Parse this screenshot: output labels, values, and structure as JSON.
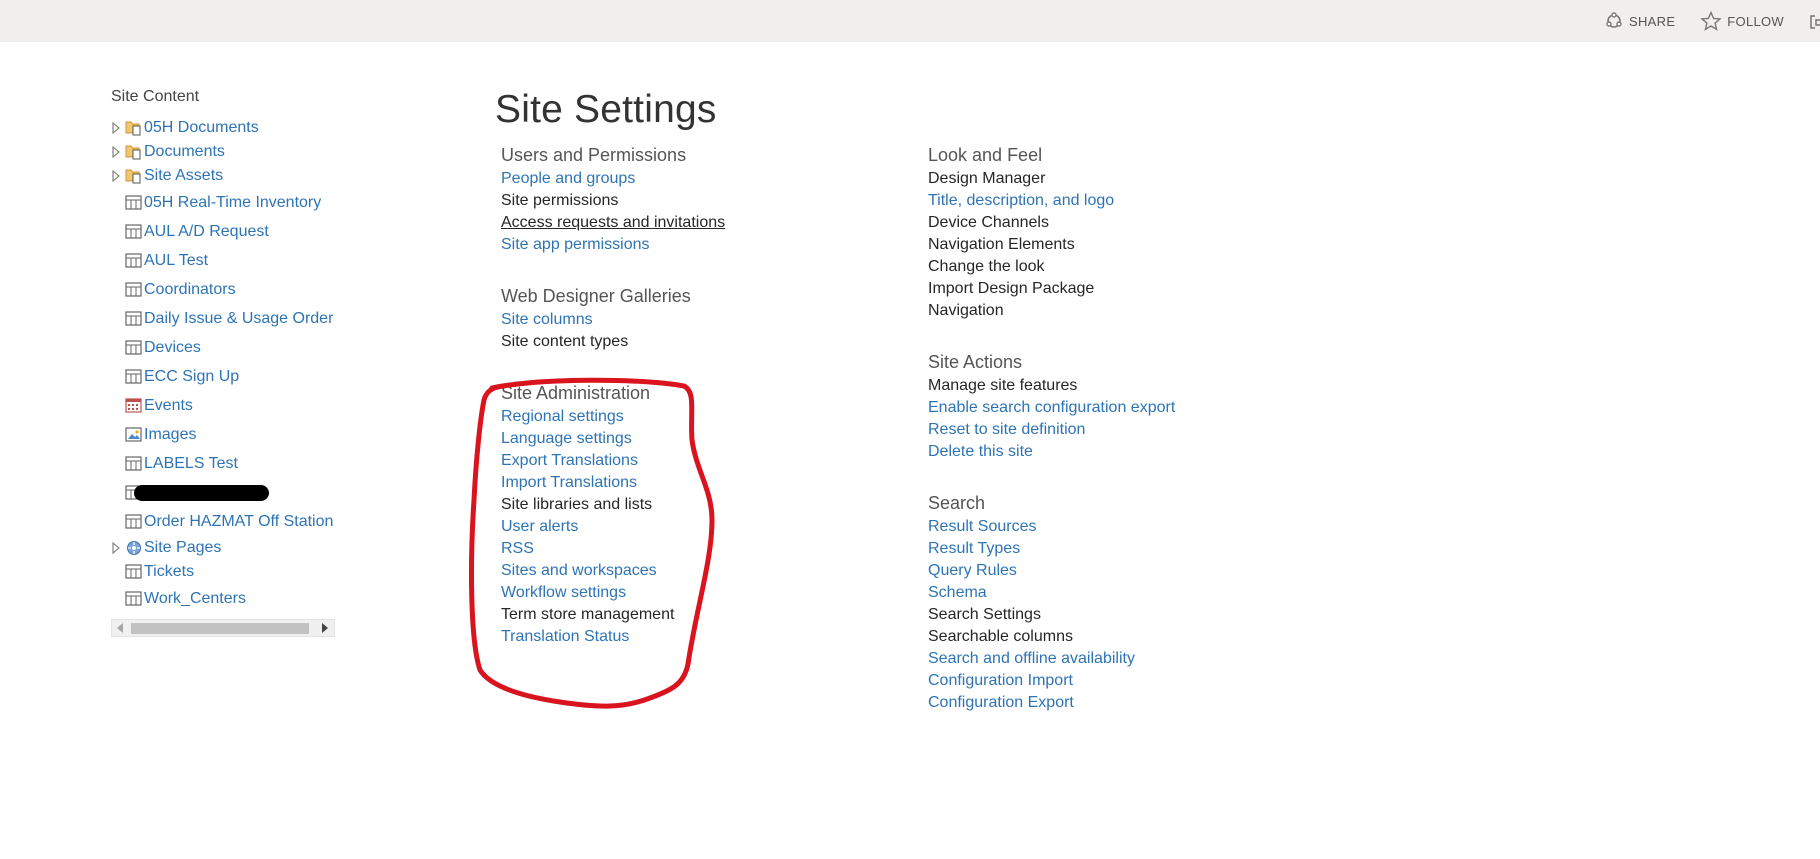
{
  "topbar": {
    "share_label": "SHARE",
    "follow_label": "FOLLOW"
  },
  "leftnav": {
    "title": "Site Content",
    "items": [
      {
        "label": "05H Documents",
        "icon": "library-folder-icon",
        "expandable": true
      },
      {
        "label": "Documents",
        "icon": "library-folder-icon",
        "expandable": true
      },
      {
        "label": "Site Assets",
        "icon": "library-folder-icon",
        "expandable": true
      },
      {
        "label": "05H Real-Time Inventory",
        "icon": "list-icon",
        "expandable": false
      },
      {
        "label": "AUL A/D Request",
        "icon": "list-icon",
        "expandable": false
      },
      {
        "label": "AUL Test",
        "icon": "list-icon",
        "expandable": false
      },
      {
        "label": "Coordinators",
        "icon": "list-icon",
        "expandable": false
      },
      {
        "label": "Daily Issue & Usage Order",
        "icon": "list-icon",
        "expandable": false
      },
      {
        "label": "Devices",
        "icon": "list-icon",
        "expandable": false
      },
      {
        "label": "ECC Sign Up",
        "icon": "list-icon",
        "expandable": false
      },
      {
        "label": "Events",
        "icon": "calendar-icon",
        "expandable": false
      },
      {
        "label": "Images",
        "icon": "image-library-icon",
        "expandable": false
      },
      {
        "label": "LABELS Test",
        "icon": "list-icon",
        "expandable": false
      },
      {
        "label": "",
        "icon": "list-icon",
        "expandable": false,
        "redacted": true
      },
      {
        "label": "Order HAZMAT Off Station",
        "icon": "list-icon",
        "expandable": false
      },
      {
        "label": "Site Pages",
        "icon": "site-pages-icon",
        "expandable": true
      },
      {
        "label": "Tickets",
        "icon": "list-icon",
        "expandable": false
      },
      {
        "label": "Work_Centers",
        "icon": "list-icon",
        "expandable": false
      }
    ]
  },
  "main": {
    "title": "Site Settings",
    "left_column": [
      {
        "title": "Users and Permissions",
        "links": [
          {
            "label": "People and groups",
            "style": "blue"
          },
          {
            "label": "Site permissions",
            "style": "dark"
          },
          {
            "label": "Access requests and invitations",
            "style": "underline"
          },
          {
            "label": "Site app permissions",
            "style": "blue"
          }
        ]
      },
      {
        "title": "Web Designer Galleries",
        "links": [
          {
            "label": "Site columns",
            "style": "blue"
          },
          {
            "label": "Site content types",
            "style": "dark"
          }
        ]
      },
      {
        "title": "Site Administration",
        "links": [
          {
            "label": "Regional settings",
            "style": "blue"
          },
          {
            "label": "Language settings",
            "style": "blue"
          },
          {
            "label": "Export Translations",
            "style": "blue"
          },
          {
            "label": "Import Translations",
            "style": "blue"
          },
          {
            "label": "Site libraries and lists",
            "style": "dark"
          },
          {
            "label": "User alerts",
            "style": "blue"
          },
          {
            "label": "RSS",
            "style": "blue"
          },
          {
            "label": "Sites and workspaces",
            "style": "blue"
          },
          {
            "label": "Workflow settings",
            "style": "blue"
          },
          {
            "label": "Term store management",
            "style": "dark"
          },
          {
            "label": "Translation Status",
            "style": "blue"
          }
        ]
      }
    ],
    "right_column": [
      {
        "title": "Look and Feel",
        "links": [
          {
            "label": "Design Manager",
            "style": "dark"
          },
          {
            "label": "Title, description, and logo",
            "style": "blue"
          },
          {
            "label": "Device Channels",
            "style": "dark"
          },
          {
            "label": "Navigation Elements",
            "style": "dark"
          },
          {
            "label": "Change the look",
            "style": "dark"
          },
          {
            "label": "Import Design Package",
            "style": "dark"
          },
          {
            "label": "Navigation",
            "style": "dark"
          }
        ]
      },
      {
        "title": "Site Actions",
        "links": [
          {
            "label": "Manage site features",
            "style": "dark"
          },
          {
            "label": "Enable search configuration export",
            "style": "blue"
          },
          {
            "label": "Reset to site definition",
            "style": "blue"
          },
          {
            "label": "Delete this site",
            "style": "blue"
          }
        ]
      },
      {
        "title": "Search",
        "links": [
          {
            "label": "Result Sources",
            "style": "blue"
          },
          {
            "label": "Result Types",
            "style": "blue"
          },
          {
            "label": "Query Rules",
            "style": "blue"
          },
          {
            "label": "Schema",
            "style": "blue"
          },
          {
            "label": "Search Settings",
            "style": "dark"
          },
          {
            "label": "Searchable columns",
            "style": "dark"
          },
          {
            "label": "Search and offline availability",
            "style": "blue"
          },
          {
            "label": "Configuration Import",
            "style": "blue"
          },
          {
            "label": "Configuration Export",
            "style": "blue"
          }
        ]
      }
    ]
  },
  "colors": {
    "link_blue": "#2e74b5",
    "text_dark": "#262626",
    "annotation_red": "#d9141e",
    "topbar_bg": "#f0efee"
  }
}
